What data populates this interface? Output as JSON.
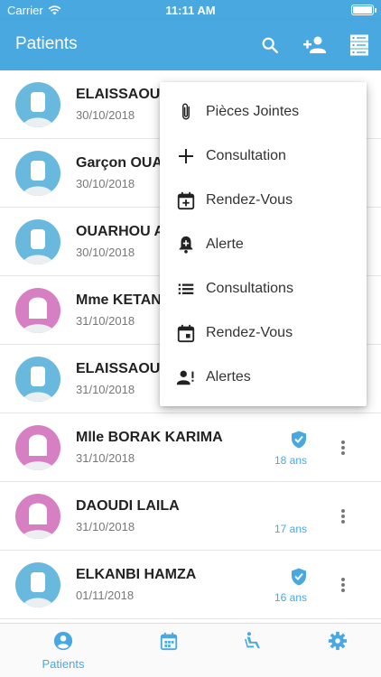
{
  "status_bar": {
    "carrier": "Carrier",
    "time": "11:11 AM"
  },
  "header": {
    "title": "Patients"
  },
  "colors": {
    "primary": "#4aa8e0",
    "avatar_male": "#69b9de",
    "avatar_female": "#d77fc3"
  },
  "patients": [
    {
      "name": "ELAISSAOUI",
      "date": "30/10/2018",
      "age": "",
      "gender": "male",
      "verified": false
    },
    {
      "name": "Garçon OUA",
      "date": "30/10/2018",
      "age": "",
      "gender": "male",
      "verified": false
    },
    {
      "name": "OUARHOU A",
      "date": "30/10/2018",
      "age": "",
      "gender": "male",
      "verified": false
    },
    {
      "name": "Mme KETAN",
      "date": "31/10/2018",
      "age": "",
      "gender": "female",
      "verified": false
    },
    {
      "name": "ELAISSAOUI",
      "date": "31/10/2018",
      "age": "",
      "gender": "male",
      "verified": false
    },
    {
      "name": "Mlle BORAK KARIMA",
      "date": "31/10/2018",
      "age": "18 ans",
      "gender": "female",
      "verified": true
    },
    {
      "name": "DAOUDI LAILA",
      "date": "31/10/2018",
      "age": "17 ans",
      "gender": "female",
      "verified": false
    },
    {
      "name": "ELKANBI HAMZA",
      "date": "01/11/2018",
      "age": "16 ans",
      "gender": "male",
      "verified": true
    }
  ],
  "menu": {
    "items": [
      {
        "label": "Pièces Jointes",
        "icon": "paperclip-icon"
      },
      {
        "label": "Consultation",
        "icon": "plus-icon"
      },
      {
        "label": "Rendez-Vous",
        "icon": "calendar-plus-icon"
      },
      {
        "label": "Alerte",
        "icon": "bell-plus-icon"
      },
      {
        "label": "Consultations",
        "icon": "list-icon"
      },
      {
        "label": "Rendez-Vous",
        "icon": "calendar-icon"
      },
      {
        "label": "Alertes",
        "icon": "person-alert-icon"
      }
    ]
  },
  "tabs": [
    {
      "label": "Patients",
      "icon": "account-circle-icon",
      "active": true
    },
    {
      "label": "",
      "icon": "calendar-icon",
      "active": false
    },
    {
      "label": "",
      "icon": "seat-recline-icon",
      "active": false
    },
    {
      "label": "",
      "icon": "gear-icon",
      "active": false
    }
  ]
}
